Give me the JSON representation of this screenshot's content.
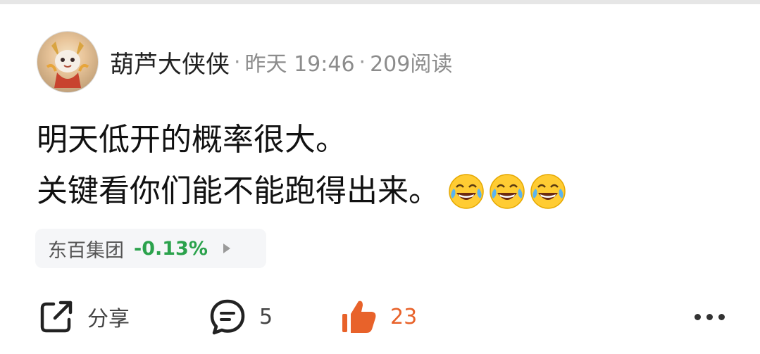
{
  "post": {
    "author": "葫芦大侠侠",
    "separator": "·",
    "time": "昨天 19:46",
    "reads": "209阅读",
    "lines": [
      "明天低开的概率很大。",
      "关键看你们能不能跑得出来。"
    ],
    "emoji_name": "laughing-crying-emoji"
  },
  "stock": {
    "name": "东百集团",
    "change": "-0.13%",
    "change_color": "#2ba24c"
  },
  "actions": {
    "share_label": "分享",
    "comment_count": "5",
    "like_count": "23",
    "like_color": "#e8622a"
  }
}
